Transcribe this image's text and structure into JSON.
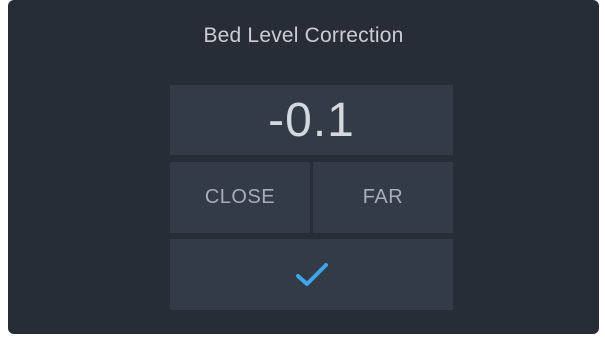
{
  "dialog": {
    "title": "Bed Level Correction",
    "value": "-0.1",
    "close_label": "CLOSE",
    "far_label": "FAR",
    "confirm_icon": "checkmark-icon"
  },
  "colors": {
    "background": "#272d36",
    "panel": "#333b46",
    "accent": "#3fa4e8"
  }
}
